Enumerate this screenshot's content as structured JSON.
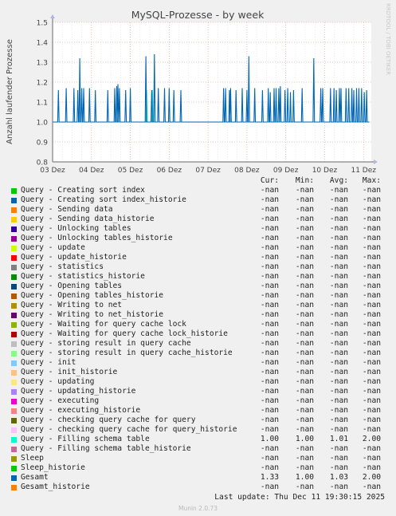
{
  "chart_data": {
    "type": "line",
    "title": "MySQL-Prozesse - by week",
    "ylabel": "Anzahl laufender Prozesse",
    "xlabel": "",
    "ylim": [
      0.8,
      1.5
    ],
    "yticks": [
      "0.8",
      "0.9",
      "1.0",
      "1.1",
      "1.2",
      "1.3",
      "1.4",
      "1.5"
    ],
    "xticks": [
      "03 Dez",
      "04 Dez",
      "05 Dez",
      "06 Dez",
      "07 Dez",
      "08 Dez",
      "09 Dez",
      "10 Dez",
      "11 Dez"
    ],
    "xlim": [
      0,
      8.2
    ],
    "baseline": 1.0,
    "grid": true,
    "series": [
      {
        "name": "Gesamt",
        "color": "#0066b3",
        "spikes": [
          [
            0.15,
            1.16
          ],
          [
            0.35,
            1.17
          ],
          [
            0.55,
            1.17
          ],
          [
            0.65,
            1.16
          ],
          [
            0.7,
            1.32
          ],
          [
            0.75,
            1.17
          ],
          [
            0.8,
            1.17
          ],
          [
            0.95,
            1.17
          ],
          [
            1.1,
            1.16
          ],
          [
            1.42,
            1.16
          ],
          [
            1.6,
            1.17
          ],
          [
            1.65,
            1.18
          ],
          [
            1.68,
            1.19
          ],
          [
            1.72,
            1.17
          ],
          [
            1.88,
            1.16
          ],
          [
            2.0,
            1.17
          ],
          [
            2.4,
            1.33
          ],
          [
            2.55,
            1.16
          ],
          [
            2.62,
            1.34
          ],
          [
            2.72,
            1.17
          ],
          [
            2.88,
            1.17
          ],
          [
            3.0,
            1.17
          ],
          [
            3.12,
            1.16
          ],
          [
            3.3,
            1.16
          ],
          [
            4.4,
            1.17
          ],
          [
            4.45,
            1.17
          ],
          [
            4.55,
            1.16
          ],
          [
            4.58,
            1.17
          ],
          [
            4.72,
            1.16
          ],
          [
            4.88,
            1.17
          ],
          [
            5.0,
            1.16
          ],
          [
            5.05,
            1.33
          ],
          [
            5.2,
            1.17
          ],
          [
            5.4,
            1.16
          ],
          [
            5.55,
            1.17
          ],
          [
            5.6,
            1.15
          ],
          [
            5.7,
            1.17
          ],
          [
            5.75,
            1.17
          ],
          [
            5.82,
            1.17
          ],
          [
            5.86,
            1.18
          ],
          [
            5.98,
            1.16
          ],
          [
            6.05,
            1.17
          ],
          [
            6.12,
            1.15
          ],
          [
            6.2,
            1.16
          ],
          [
            6.42,
            1.17
          ],
          [
            6.72,
            1.32
          ],
          [
            6.9,
            1.17
          ],
          [
            6.95,
            1.17
          ],
          [
            7.15,
            1.17
          ],
          [
            7.24,
            1.17
          ],
          [
            7.3,
            1.16
          ],
          [
            7.38,
            1.17
          ],
          [
            7.42,
            1.17
          ],
          [
            7.55,
            1.17
          ],
          [
            7.62,
            1.17
          ],
          [
            7.7,
            1.17
          ],
          [
            7.75,
            1.16
          ],
          [
            7.82,
            1.17
          ],
          [
            7.88,
            1.17
          ],
          [
            7.95,
            1.17
          ],
          [
            8.02,
            1.15
          ],
          [
            8.08,
            1.16
          ]
        ]
      },
      {
        "name": "Query - Filling schema table",
        "color": "#00e6b3",
        "spikes": [
          [
            2.42,
            1.16
          ],
          [
            2.57,
            1.16
          ]
        ]
      }
    ]
  },
  "rrd_label": "RRDTOOL / TOBI OETIKER",
  "legend": {
    "headers": {
      "cur": "Cur:",
      "min": "Min:",
      "avg": "Avg:",
      "max": "Max:"
    },
    "rows": [
      {
        "label": "Query - Creating sort index",
        "color": "#00cc00",
        "cur": "-nan",
        "min": "-nan",
        "avg": "-nan",
        "max": "-nan"
      },
      {
        "label": "Query - Creating sort index_historie",
        "color": "#0066b3",
        "cur": "-nan",
        "min": "-nan",
        "avg": "-nan",
        "max": "-nan"
      },
      {
        "label": "Query - Sending data",
        "color": "#ff8000",
        "cur": "-nan",
        "min": "-nan",
        "avg": "-nan",
        "max": "-nan"
      },
      {
        "label": "Query - Sending data_historie",
        "color": "#ffcc00",
        "cur": "-nan",
        "min": "-nan",
        "avg": "-nan",
        "max": "-nan"
      },
      {
        "label": "Query - Unlocking tables",
        "color": "#330099",
        "cur": "-nan",
        "min": "-nan",
        "avg": "-nan",
        "max": "-nan"
      },
      {
        "label": "Query - Unlocking tables_historie",
        "color": "#990099",
        "cur": "-nan",
        "min": "-nan",
        "avg": "-nan",
        "max": "-nan"
      },
      {
        "label": "Query - update",
        "color": "#ccff00",
        "cur": "-nan",
        "min": "-nan",
        "avg": "-nan",
        "max": "-nan"
      },
      {
        "label": "Query - update_historie",
        "color": "#ff0000",
        "cur": "-nan",
        "min": "-nan",
        "avg": "-nan",
        "max": "-nan"
      },
      {
        "label": "Query - statistics",
        "color": "#808080",
        "cur": "-nan",
        "min": "-nan",
        "avg": "-nan",
        "max": "-nan"
      },
      {
        "label": "Query - statistics_historie",
        "color": "#008f00",
        "cur": "-nan",
        "min": "-nan",
        "avg": "-nan",
        "max": "-nan"
      },
      {
        "label": "Query - Opening tables",
        "color": "#00487d",
        "cur": "-nan",
        "min": "-nan",
        "avg": "-nan",
        "max": "-nan"
      },
      {
        "label": "Query - Opening tables_historie",
        "color": "#b35a00",
        "cur": "-nan",
        "min": "-nan",
        "avg": "-nan",
        "max": "-nan"
      },
      {
        "label": "Query - Writing to net",
        "color": "#b38f00",
        "cur": "-nan",
        "min": "-nan",
        "avg": "-nan",
        "max": "-nan"
      },
      {
        "label": "Query - Writing to net_historie",
        "color": "#6b006b",
        "cur": "-nan",
        "min": "-nan",
        "avg": "-nan",
        "max": "-nan"
      },
      {
        "label": "Query - Waiting for query cache lock",
        "color": "#8fb300",
        "cur": "-nan",
        "min": "-nan",
        "avg": "-nan",
        "max": "-nan"
      },
      {
        "label": "Query - Waiting for query cache lock_historie",
        "color": "#b30000",
        "cur": "-nan",
        "min": "-nan",
        "avg": "-nan",
        "max": "-nan"
      },
      {
        "label": "Query - storing result in query cache",
        "color": "#bebebe",
        "cur": "-nan",
        "min": "-nan",
        "avg": "-nan",
        "max": "-nan"
      },
      {
        "label": "Query - storing result in query cache_historie",
        "color": "#80ff80",
        "cur": "-nan",
        "min": "-nan",
        "avg": "-nan",
        "max": "-nan"
      },
      {
        "label": "Query - init",
        "color": "#80c9ff",
        "cur": "-nan",
        "min": "-nan",
        "avg": "-nan",
        "max": "-nan"
      },
      {
        "label": "Query - init_historie",
        "color": "#ffc080",
        "cur": "-nan",
        "min": "-nan",
        "avg": "-nan",
        "max": "-nan"
      },
      {
        "label": "Query - updating",
        "color": "#ffe680",
        "cur": "-nan",
        "min": "-nan",
        "avg": "-nan",
        "max": "-nan"
      },
      {
        "label": "Query - updating_historie",
        "color": "#aa80ff",
        "cur": "-nan",
        "min": "-nan",
        "avg": "-nan",
        "max": "-nan"
      },
      {
        "label": "Query - executing",
        "color": "#ee00cc",
        "cur": "-nan",
        "min": "-nan",
        "avg": "-nan",
        "max": "-nan"
      },
      {
        "label": "Query - executing_historie",
        "color": "#ff8080",
        "cur": "-nan",
        "min": "-nan",
        "avg": "-nan",
        "max": "-nan"
      },
      {
        "label": "Query - checking query cache for query",
        "color": "#666600",
        "cur": "-nan",
        "min": "-nan",
        "avg": "-nan",
        "max": "-nan"
      },
      {
        "label": "Query - checking query cache for query_historie",
        "color": "#ffbfff",
        "cur": "-nan",
        "min": "-nan",
        "avg": "-nan",
        "max": "-nan"
      },
      {
        "label": "Query - Filling schema table",
        "color": "#00ffcc",
        "cur": "1.00",
        "min": "1.00",
        "avg": "1.01",
        "max": "2.00"
      },
      {
        "label": "Query - Filling schema table_historie",
        "color": "#cc6699",
        "cur": "-nan",
        "min": "-nan",
        "avg": "-nan",
        "max": "-nan"
      },
      {
        "label": "Sleep",
        "color": "#999900",
        "cur": "-nan",
        "min": "-nan",
        "avg": "-nan",
        "max": "-nan"
      },
      {
        "label": "Sleep_historie",
        "color": "#00cc00",
        "cur": "-nan",
        "min": "-nan",
        "avg": "-nan",
        "max": "-nan"
      },
      {
        "label": "Gesamt",
        "color": "#0066b3",
        "cur": "1.33",
        "min": "1.00",
        "avg": "1.03",
        "max": "2.00"
      },
      {
        "label": "Gesamt_historie",
        "color": "#ff8000",
        "cur": "-nan",
        "min": "-nan",
        "avg": "-nan",
        "max": "-nan"
      }
    ]
  },
  "footer": {
    "last_update": "Last update: Thu Dec 11 19:30:15 2025",
    "munin": "Munin 2.0.73"
  }
}
